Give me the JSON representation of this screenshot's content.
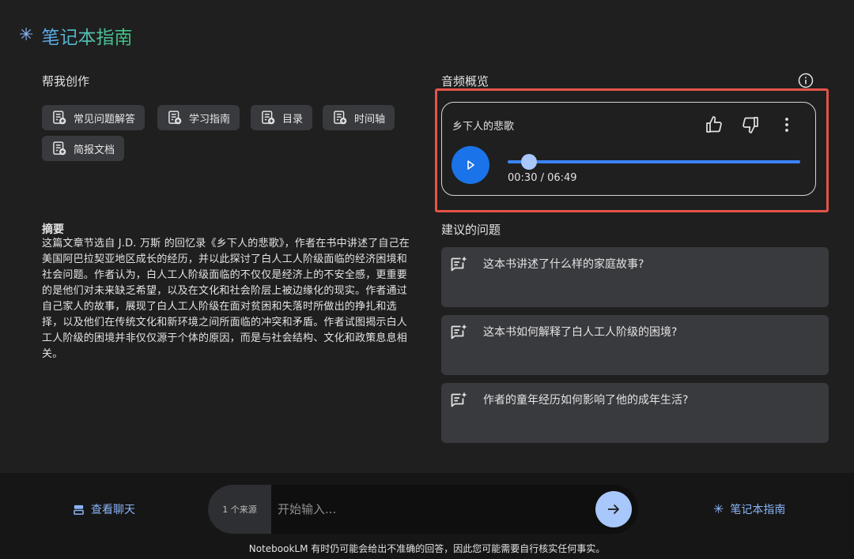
{
  "header": {
    "title": "笔记本指南",
    "icon": "sparkle-icon"
  },
  "create": {
    "label": "帮我创作",
    "chips": [
      {
        "label": "常见问题解答",
        "icon": "note-add-icon"
      },
      {
        "label": "学习指南",
        "icon": "note-add-icon"
      },
      {
        "label": "目录",
        "icon": "note-add-icon"
      },
      {
        "label": "时间轴",
        "icon": "note-add-icon"
      },
      {
        "label": "简报文档",
        "icon": "note-add-icon"
      }
    ]
  },
  "summary": {
    "heading": "摘要",
    "text": "这篇文章节选自 J.D. 万斯 的回忆录《乡下人的悲歌》，作者在书中讲述了自己在美国阿巴拉契亚地区成长的经历，并以此探讨了白人工人阶级面临的经济困境和社会问题。作者认为，白人工人阶级面临的不仅仅是经济上的不安全感，更重要的是他们对未来缺乏希望，以及在文化和社会阶层上被边缘化的现实。作者通过自己家人的故事，展现了白人工人阶级在面对贫困和失落时所做出的挣扎和选择，以及他们在传统文化和新环境之间所面临的冲突和矛盾。作者试图揭示白人工人阶级的困境并非仅仅源于个体的原因，而是与社会结构、文化和政策息息相关。"
  },
  "audio": {
    "label": "音频概览",
    "title": "乡下人的悲歌",
    "current": "00:30",
    "total": "06:49",
    "time_text": "00:30 / 06:49",
    "progress": 0.073,
    "accent": "#1a73e8"
  },
  "suggestions": {
    "label": "建议的问题",
    "items": [
      {
        "text": "这本书讲述了什么样的家庭故事?"
      },
      {
        "text": "这本书如何解释了白人工人阶级的困境?"
      },
      {
        "text": "作者的童年经历如何影响了他的成年生活?"
      }
    ]
  },
  "footer": {
    "view_chat": "查看聊天",
    "source_count": "1 个来源",
    "input_placeholder": "开始输入...",
    "guide_label": "笔记本指南",
    "disclaimer": "NotebookLM 有时仍可能会给出不准确的回答，因此您可能需要自行核实任何事实。"
  }
}
